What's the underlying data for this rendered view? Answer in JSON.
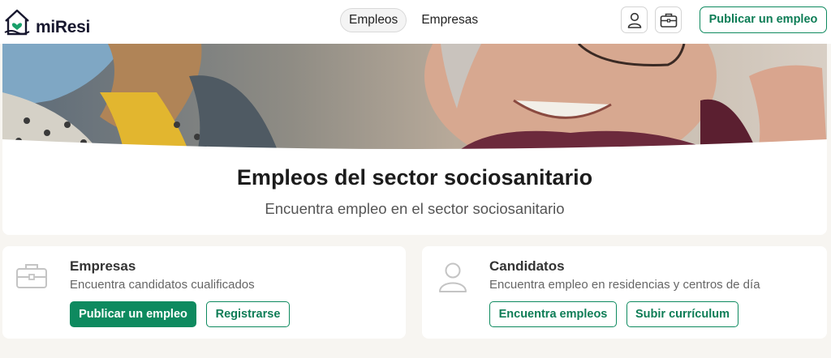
{
  "brand": {
    "prefix": "mi",
    "name": "Resi",
    "accent": "#0e8a5f"
  },
  "nav": {
    "tabs": [
      {
        "label": "Empleos",
        "active": true
      },
      {
        "label": "Empresas",
        "active": false
      }
    ]
  },
  "header": {
    "user_icon": "user-icon",
    "briefcase_icon": "briefcase-icon",
    "publish_label": "Publicar un empleo"
  },
  "hero": {
    "title": "Empleos del sector sociosanitario",
    "subtitle": "Encuentra empleo en el sector sociosanitario"
  },
  "cards": {
    "empresas": {
      "icon": "briefcase-icon",
      "title": "Empresas",
      "description": "Encuentra candidatos cualificados",
      "primary_label": "Publicar un empleo",
      "secondary_label": "Registrarse"
    },
    "candidatos": {
      "icon": "user-icon",
      "title": "Candidatos",
      "description": "Encuentra empleo en residencias y centros de día",
      "primary_label": "Encuentra empleos",
      "secondary_label": "Subir currículum"
    }
  }
}
